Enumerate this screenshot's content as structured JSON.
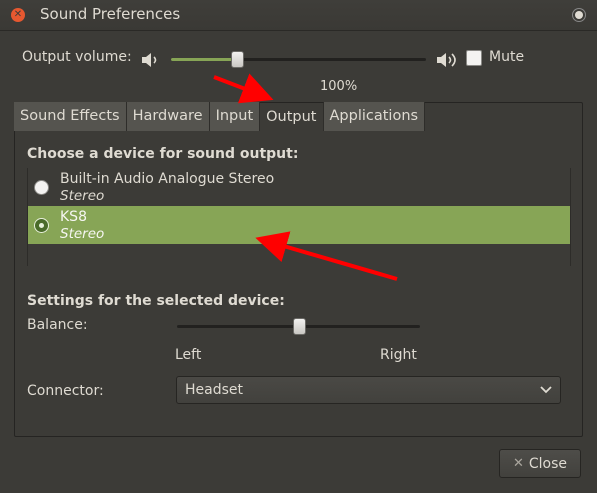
{
  "window": {
    "title": "Sound Preferences"
  },
  "volume": {
    "label": "Output volume:",
    "percent_text": "100%",
    "level": 0.26,
    "mute_label": "Mute",
    "mute_checked": false
  },
  "tabs": [
    {
      "label": "Sound Effects",
      "active": false
    },
    {
      "label": "Hardware",
      "active": false
    },
    {
      "label": "Input",
      "active": false
    },
    {
      "label": "Output",
      "active": true
    },
    {
      "label": "Applications",
      "active": false
    }
  ],
  "output": {
    "choose_label": "Choose a device for sound output:",
    "devices": [
      {
        "name": "Built-in Audio Analogue Stereo",
        "profile": "Stereo",
        "selected": false
      },
      {
        "name": "KS8",
        "profile": "Stereo",
        "selected": true
      }
    ]
  },
  "settings": {
    "label": "Settings for the selected device:",
    "balance_label": "Balance:",
    "balance_value": 0.5,
    "left_label": "Left",
    "right_label": "Right",
    "connector_label": "Connector:",
    "connector_value": "Headset"
  },
  "footer": {
    "close_label": "Close"
  },
  "colors": {
    "accent": "#87a556",
    "annotation_arrow": "#ff0000",
    "window_bg": "#3c3b37",
    "close_dot": "#e65830"
  },
  "icons": {
    "volume_low": "speaker-low-icon",
    "volume_high": "speaker-high-icon",
    "close": "close-x-icon",
    "dropdown": "chevron-down-icon"
  }
}
